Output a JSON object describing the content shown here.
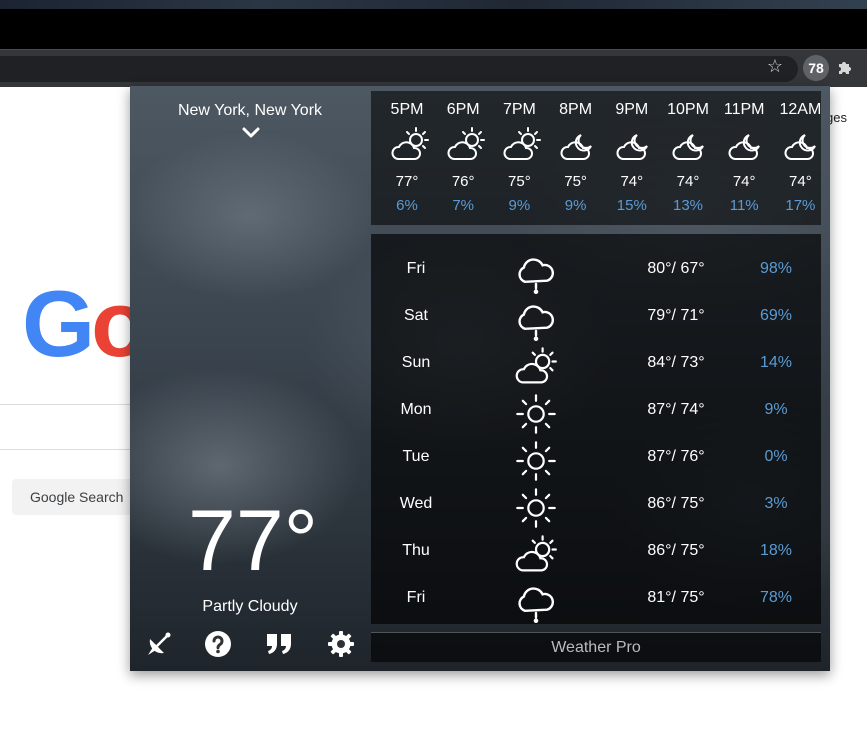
{
  "toolbar": {
    "extension_badge": "78"
  },
  "google_page": {
    "logo_g": "G",
    "logo_o": "o",
    "partial_link": "ges",
    "search_button": "Google Search"
  },
  "weather": {
    "location": "New York, New York",
    "current_temp": "77°",
    "current_condition": "Partly Cloudy",
    "hourly": [
      {
        "time": "5PM",
        "icon": "partly-cloudy-icon",
        "temp": "77°",
        "precip": "6%"
      },
      {
        "time": "6PM",
        "icon": "partly-cloudy-icon",
        "temp": "76°",
        "precip": "7%"
      },
      {
        "time": "7PM",
        "icon": "partly-cloudy-icon",
        "temp": "75°",
        "precip": "9%"
      },
      {
        "time": "8PM",
        "icon": "cloudy-night-icon",
        "temp": "75°",
        "precip": "9%"
      },
      {
        "time": "9PM",
        "icon": "cloudy-night-icon",
        "temp": "74°",
        "precip": "15%"
      },
      {
        "time": "10PM",
        "icon": "cloudy-night-icon",
        "temp": "74°",
        "precip": "13%"
      },
      {
        "time": "11PM",
        "icon": "cloudy-night-icon",
        "temp": "74°",
        "precip": "11%"
      },
      {
        "time": "12AM",
        "icon": "cloudy-night-icon",
        "temp": "74°",
        "precip": "17%"
      }
    ],
    "daily": [
      {
        "day": "Fri",
        "icon": "rain-cloud-icon",
        "temps": "80°/ 67°",
        "precip": "98%"
      },
      {
        "day": "Sat",
        "icon": "rain-cloud-icon",
        "temps": "79°/ 71°",
        "precip": "69%"
      },
      {
        "day": "Sun",
        "icon": "partly-cloudy-icon",
        "temps": "84°/ 73°",
        "precip": "14%"
      },
      {
        "day": "Mon",
        "icon": "sun-icon",
        "temps": "87°/ 74°",
        "precip": "9%"
      },
      {
        "day": "Tue",
        "icon": "sun-icon",
        "temps": "87°/ 76°",
        "precip": "0%"
      },
      {
        "day": "Wed",
        "icon": "sun-icon",
        "temps": "86°/ 75°",
        "precip": "3%"
      },
      {
        "day": "Thu",
        "icon": "partly-cloudy-icon",
        "temps": "86°/ 75°",
        "precip": "18%"
      },
      {
        "day": "Fri",
        "icon": "rain-cloud-icon",
        "temps": "81°/ 75°",
        "precip": "78%"
      }
    ],
    "footer": "Weather Pro"
  },
  "colors": {
    "precip_blue": "#5b9bd5",
    "google_blue": "#4285f4",
    "google_red": "#ea4335"
  }
}
